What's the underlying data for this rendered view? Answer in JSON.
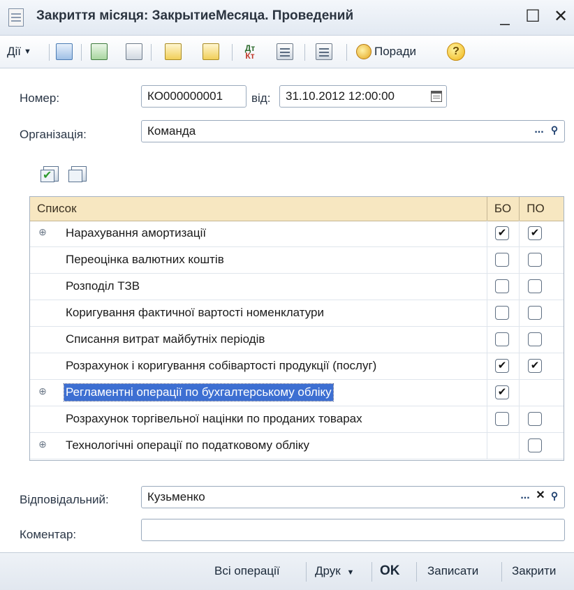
{
  "window": {
    "title": "Закриття місяця: ЗакрытиеМесяца. Проведений",
    "minimize": "_",
    "maximize": "☐",
    "close": "✕"
  },
  "toolbar": {
    "actions_label": "Дії",
    "tips_label": "Поради",
    "help_glyph": "?",
    "dtkt_top": "Дт",
    "dtkt_bottom": "Кт"
  },
  "form": {
    "number_label": "Номер:",
    "number_value": "КО000000001",
    "from_label": "від:",
    "date_value": "31.10.2012 12:00:00",
    "org_label": "Організація:",
    "org_value": "Команда",
    "responsible_label": "Відповідальний:",
    "responsible_value": "Кузьменко",
    "comment_label": "Коментар:",
    "comment_value": "",
    "select_btn": "...",
    "clear_btn": "✕",
    "search_btn": "🔍"
  },
  "grid": {
    "columns": [
      "Список",
      "БО",
      "ПО"
    ],
    "rows": [
      {
        "name": "Нарахування амортизації",
        "expandable": true,
        "bo": true,
        "po": true
      },
      {
        "name": "Переоцінка валютних коштів",
        "expandable": false,
        "bo": false,
        "po": false
      },
      {
        "name": "Розподіл ТЗВ",
        "expandable": false,
        "bo": false,
        "po": false
      },
      {
        "name": "Коригування фактичної вартості номенклатури",
        "expandable": false,
        "bo": false,
        "po": false
      },
      {
        "name": "Списання витрат майбутніх періодів",
        "expandable": false,
        "bo": false,
        "po": false
      },
      {
        "name": "Розрахунок і коригування собівартості продукції (послуг)",
        "expandable": false,
        "bo": true,
        "po": true
      },
      {
        "name": "Регламентні операції по бухгалтерському обліку",
        "expandable": true,
        "bo": true,
        "po": null,
        "selected": true
      },
      {
        "name": "Розрахунок торгівельної націнки по проданих товарах",
        "expandable": false,
        "bo": false,
        "po": false
      },
      {
        "name": "Технологічні операції по податковому обліку",
        "expandable": true,
        "bo": null,
        "po": false
      }
    ],
    "check_glyph": "✔",
    "expand_glyph": "⊕"
  },
  "footer": {
    "all_ops": "Всі операції",
    "print": "Друк",
    "ok": "OK",
    "save": "Записати",
    "close": "Закрити"
  },
  "icons": [
    "post-icon",
    "refresh-icon",
    "copy-icon",
    "export-icon",
    "import-icon",
    "dt-kt-icon",
    "report-icon",
    "structure-icon",
    "tips-icon",
    "help-icon"
  ],
  "colors": {
    "grid_header": "#f7e7c1",
    "selection": "#3d6fd2"
  }
}
